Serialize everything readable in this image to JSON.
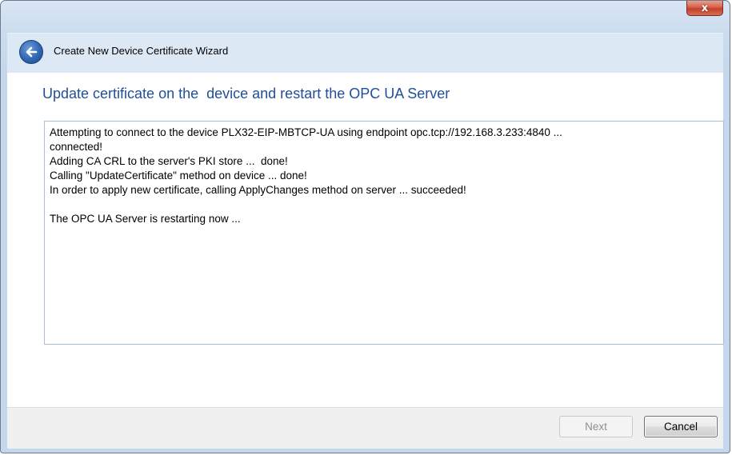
{
  "window": {
    "close_label": "x",
    "wizard_title": "Create New Device Certificate Wizard"
  },
  "icons": {
    "back": "back-arrow-icon",
    "close": "close-icon"
  },
  "main": {
    "heading": "Update certificate on the  device and restart the OPC UA Server",
    "log_lines": [
      "Attempting to connect to the device PLX32-EIP-MBTCP-UA using endpoint opc.tcp://192.168.3.233:4840 ...",
      "connected!",
      "Adding CA CRL to the server's PKI store ...  done!",
      "Calling \"UpdateCertificate\" method on device ... done!",
      "In order to apply new certificate, calling ApplyChanges method on server ... succeeded!",
      "",
      "The OPC UA Server is restarting now ..."
    ]
  },
  "footer": {
    "next_label": "Next",
    "cancel_label": "Cancel"
  },
  "colors": {
    "heading": "#1f4e9b",
    "close_button": "#c3402a",
    "frame": "#c4d7ec"
  }
}
